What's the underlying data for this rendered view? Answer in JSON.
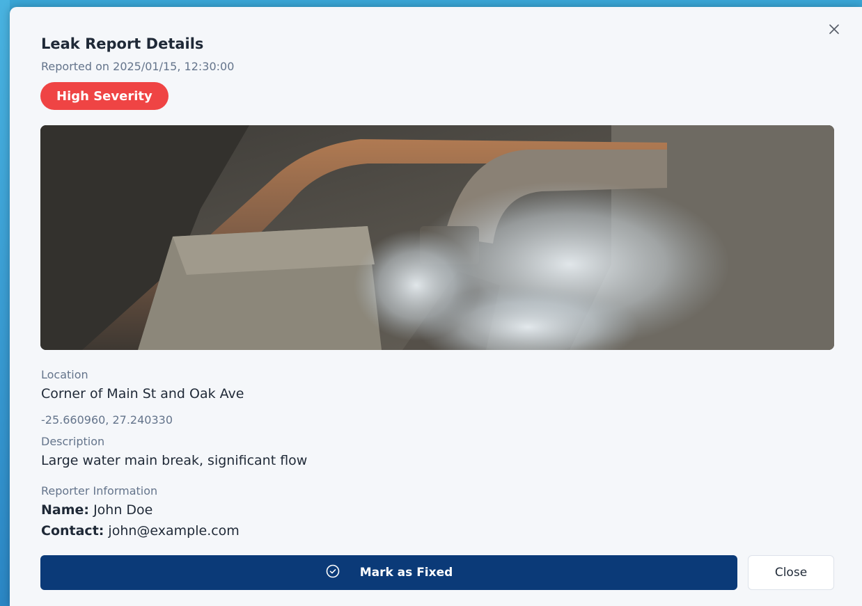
{
  "modal": {
    "title": "Leak Report Details",
    "reported": "Reported on 2025/01/15, 12:30:00",
    "severity": "High Severity",
    "colors": {
      "severity": "#ef4444",
      "primary": "#0b3a78"
    }
  },
  "location": {
    "label": "Location",
    "address": "Corner of Main St and Oak Ave",
    "coords": "-25.660960, 27.240330"
  },
  "description": {
    "label": "Description",
    "text": "Large water main break, significant flow"
  },
  "reporter": {
    "label": "Reporter Information",
    "name_label": "Name:",
    "name": "John Doe",
    "contact_label": "Contact:",
    "contact": "john@example.com"
  },
  "actions": {
    "fixed_label": "Mark as Fixed",
    "close_label": "Close"
  },
  "icons": {
    "close": "close-icon",
    "check_circle": "check-circle-icon"
  }
}
